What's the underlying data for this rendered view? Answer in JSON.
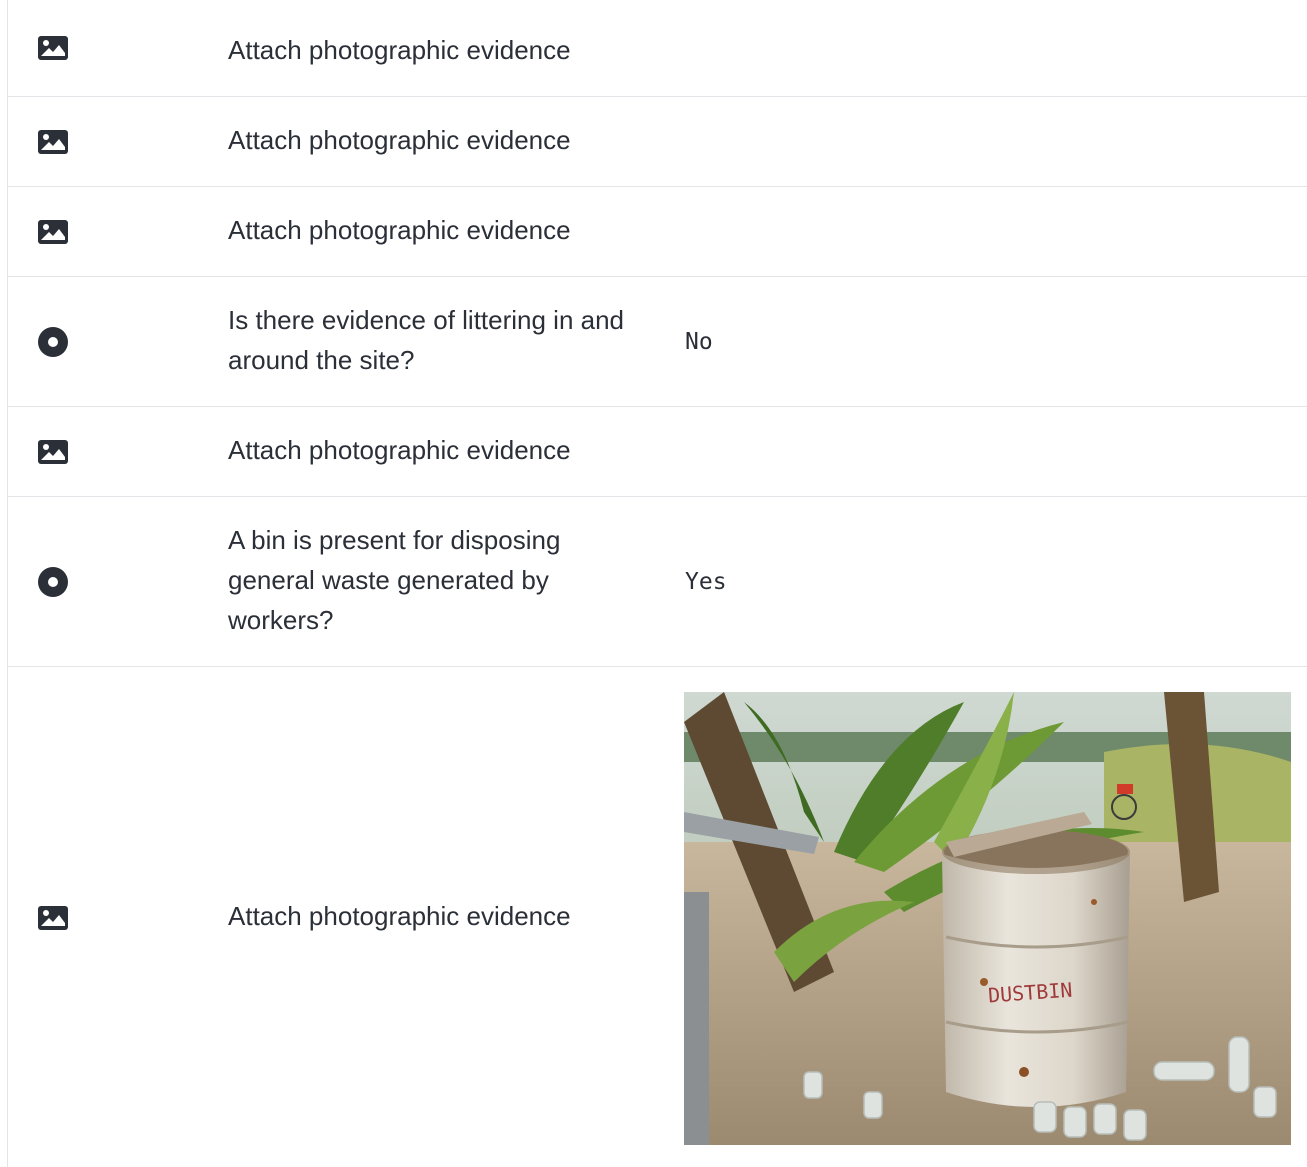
{
  "rows": [
    {
      "type": "image",
      "icon": "image-icon",
      "label": "Attach photographic evidence"
    },
    {
      "type": "image",
      "icon": "image-icon",
      "label": "Attach photographic evidence"
    },
    {
      "type": "image",
      "icon": "image-icon",
      "label": "Attach photographic evidence"
    },
    {
      "type": "radio",
      "icon": "radio-icon",
      "label": "Is there evidence of littering in and around the site?",
      "answer": "No"
    },
    {
      "type": "image",
      "icon": "image-icon",
      "label": "Attach photographic evidence"
    },
    {
      "type": "radio",
      "icon": "radio-icon",
      "label": "A bin is present for disposing general waste generated by workers?",
      "answer": "Yes"
    },
    {
      "type": "image",
      "icon": "image-icon",
      "label": "Attach photographic evidence",
      "photo_caption": "DUSTBIN"
    }
  ],
  "colors": {
    "text": "#2b2f38",
    "divider": "#e2e4e8",
    "icon": "#2b2f38"
  }
}
